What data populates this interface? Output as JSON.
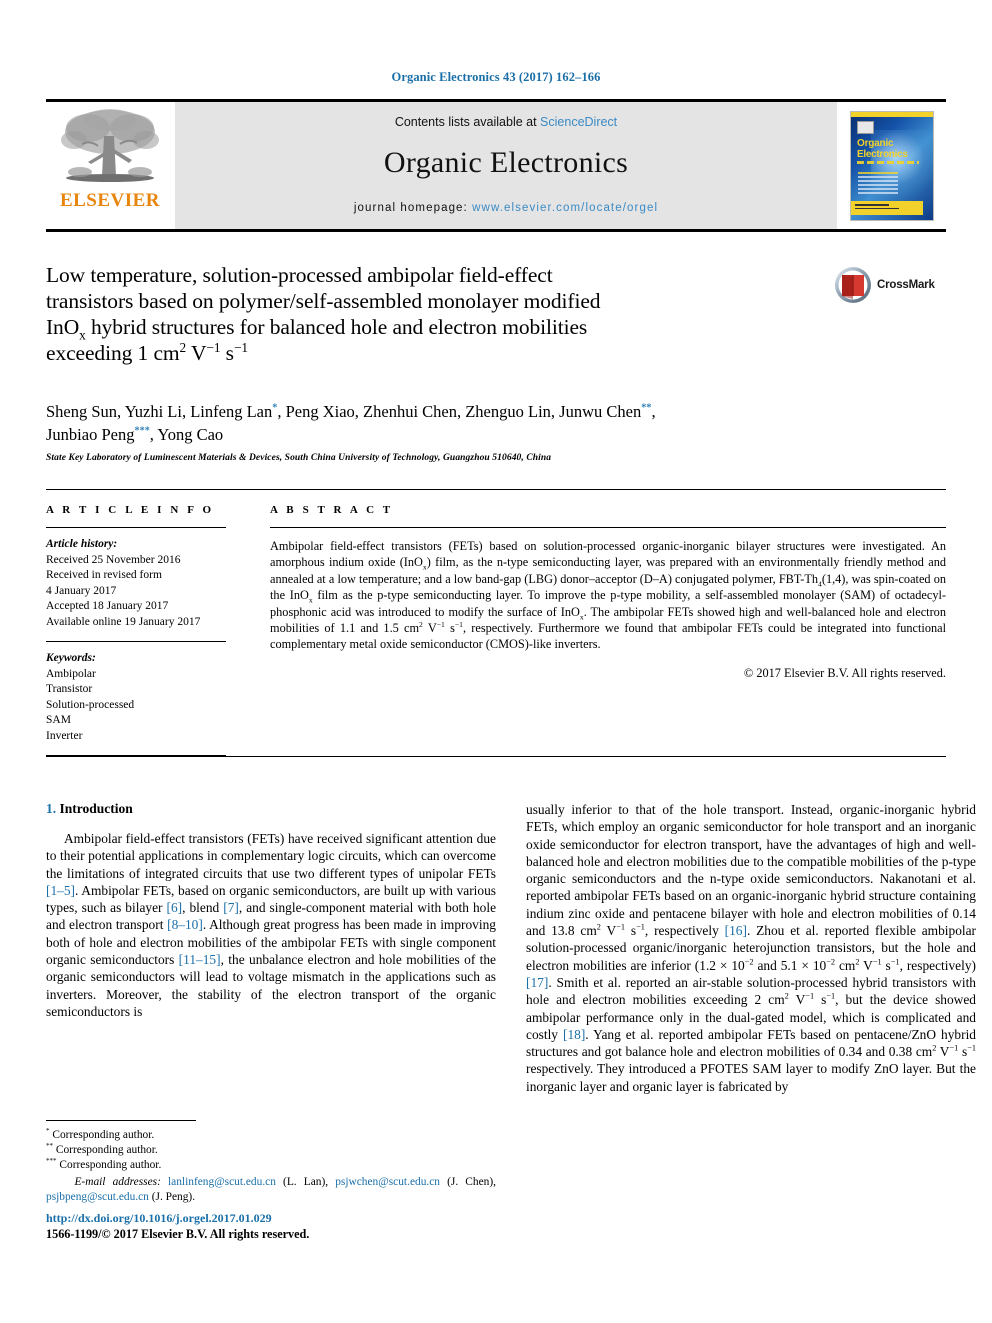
{
  "running_head": "Organic Electronics 43 (2017) 162–166",
  "masthead": {
    "publisher_logo_name": "ELSEVIER",
    "contents_prefix": "Contents lists available at ",
    "contents_link": "ScienceDirect",
    "journal_name": "Organic Electronics",
    "homepage_prefix": "journal homepage: ",
    "homepage_url": "www.elsevier.com/locate/orgel",
    "cover": {
      "line1": "Organic",
      "line2": "Electronics"
    }
  },
  "crossmark": {
    "label": "CrossMark"
  },
  "title": {
    "line1": "Low temperature, solution-processed ambipolar field-effect",
    "line2": "transistors based on polymer/self-assembled monolayer modified",
    "line3_a": "InO",
    "line3_sub": "x",
    "line3_b": " hybrid structures for balanced hole and electron mobilities",
    "line4_a": "exceeding 1 cm",
    "line4_sup1": "2",
    "line4_b": " V",
    "line4_sup2": "−1",
    "line4_c": " s",
    "line4_sup3": "−1"
  },
  "authors": {
    "line1_a": "Sheng Sun, Yuzhi Li, Linfeng Lan",
    "star1": "*",
    "line1_b": ", Peng Xiao, Zhenhui Chen, Zhenguo Lin, Junwu Chen",
    "star2": "**",
    "line1_c": ",",
    "line2_a": "Junbiao Peng",
    "star3": "***",
    "line2_b": ", Yong Cao",
    "affiliation": "State Key Laboratory of Luminescent Materials & Devices, South China University of Technology, Guangzhou 510640, China"
  },
  "article_info": {
    "heading": "A R T I C L E   I N F O",
    "history_label": "Article history:",
    "history": [
      "Received 25 November 2016",
      "Received in revised form",
      "4 January 2017",
      "Accepted 18 January 2017",
      "Available online 19 January 2017"
    ],
    "keywords_label": "Keywords:",
    "keywords": [
      "Ambipolar",
      "Transistor",
      "Solution-processed",
      "SAM",
      "Inverter"
    ]
  },
  "abstract": {
    "heading": "A B S T R A C T",
    "p1_a": "Ambipolar field-effect transistors (FETs) based on solution-processed organic-inorganic bilayer structures were investigated. An amorphous indium oxide (InO",
    "p1_sub1": "x",
    "p1_b": ") film, as the n-type semiconducting layer, was prepared with an environmentally friendly method and annealed at a low temperature; and a low band-gap (LBG) donor–acceptor (D–A) conjugated polymer, FBT-Th",
    "p1_sub2": "4",
    "p1_c": "(1,4), was spin-coated on the InO",
    "p1_sub3": "x",
    "p1_d": " film as the p-type semiconducting layer. To improve the p-type mobility, a self-assembled monolayer (SAM) of octadecyl-phosphonic acid was introduced to modify the surface of InO",
    "p1_sub4": "x",
    "p1_e": ". The ambipolar FETs showed high and well-balanced hole and electron mobilities of 1.1 and 1.5 cm",
    "p1_sup1": "2",
    "p1_f": " V",
    "p1_sup2": "−1",
    "p1_g": " s",
    "p1_sup3": "−1",
    "p1_h": ", respectively. Furthermore we found that ambipolar FETs could be integrated into functional complementary metal oxide semiconductor (CMOS)-like inverters.",
    "copyright": "© 2017 Elsevier B.V. All rights reserved."
  },
  "section": {
    "number": "1.",
    "title": "Introduction"
  },
  "left_column": {
    "p1_a": "Ambipolar field-effect transistors (FETs) have received significant attention due to their potential applications in complementary logic circuits, which can overcome the limitations of integrated circuits that use two different types of unipolar FETs ",
    "ref1": "[1–5]",
    "p1_b": ". Ambipolar FETs, based on organic semiconductors, are built up with various types, such as bilayer ",
    "ref2": "[6]",
    "p1_c": ", blend ",
    "ref3": "[7]",
    "p1_d": ", and single-component material with both hole and electron transport ",
    "ref4": "[8–10]",
    "p1_e": ". Although great progress has been made in improving both of hole and electron mobilities of the ambipolar FETs with single component organic semiconductors ",
    "ref5": "[11–15]",
    "p1_f": ", the unbalance electron and hole mobilities of the organic semiconductors will lead to voltage mismatch in the applications such as inverters. Moreover, the stability of the electron transport of the organic semiconductors is"
  },
  "right_column": {
    "p1_a": "usually inferior to that of the hole transport. Instead, organic-inorganic hybrid FETs, which employ an organic semiconductor for hole transport and an inorganic oxide semiconductor for electron transport, have the advantages of high and well-balanced hole and electron mobilities due to the compatible mobilities of the p-type organic semiconductors and the n-type oxide semiconductors. Nakanotani et al. reported ambipolar FETs based on an organic-inorganic hybrid structure containing indium zinc oxide and pentacene bilayer with hole and electron mobilities of 0.14 and 13.8 cm",
    "sup1": "2",
    "p1_b": " V",
    "sup2": "−1",
    "p1_c": " s",
    "sup3": "−1",
    "p1_d": ", respectively ",
    "ref16": "[16]",
    "p1_e": ". Zhou et al. reported flexible ambipolar solution-processed organic/inorganic heterojunction transistors, but the hole and electron mobilities are inferior (1.2 × 10",
    "sup4": "−2",
    "p1_f": " and 5.1 × 10",
    "sup5": "−2",
    "p1_g": " cm",
    "sup6": "2",
    "p1_h": " V",
    "sup7": "−1",
    "p1_i": " s",
    "sup8": "−1",
    "p1_j": ", respectively) ",
    "ref17": "[17]",
    "p1_k": ". Smith et al. reported an air-stable solution-processed hybrid transistors with hole and electron mobilities exceeding 2 cm",
    "sup9": "2",
    "p1_l": " V",
    "sup10": "−1",
    "p1_m": " s",
    "sup11": "−1",
    "p1_n": ", but the device showed ambipolar performance only in the dual-gated model, which is complicated and costly ",
    "ref18": "[18]",
    "p1_o": ". Yang et al. reported ambipolar FETs based on pentacene/ZnO hybrid structures and got balance hole and electron mobilities of 0.34 and 0.38 cm",
    "sup12": "2",
    "p1_p": " V",
    "sup13": "−1",
    "p1_q": " s",
    "sup14": "−1",
    "p1_r": " respectively. They introduced a PFOTES SAM layer to modify ZnO layer. But the inorganic layer and organic layer is fabricated by"
  },
  "footnotes": {
    "fn1_mark": "*",
    "fn1_text": " Corresponding author.",
    "fn2_mark": "**",
    "fn2_text": " Corresponding author.",
    "fn3_mark": "***",
    "fn3_text": " Corresponding author.",
    "email_label": "E-mail addresses:",
    "email1": "lanlinfeng@scut.edu.cn",
    "email1_owner": " (L. Lan), ",
    "email2": "psjwchen@scut.edu.cn",
    "email2_owner": " (J. Chen), ",
    "email3": "psjbpeng@scut.edu.cn",
    "email3_owner": " (J. Peng)."
  },
  "doi_block": {
    "doi": "http://dx.doi.org/10.1016/j.orgel.2017.01.029",
    "issn_line": "1566-1199/© 2017 Elsevier B.V. All rights reserved."
  },
  "colors": {
    "link_blue": "#1a6fa8",
    "elsevier_orange": "#E8850C",
    "masthead_gray": "#e4e4e4"
  }
}
